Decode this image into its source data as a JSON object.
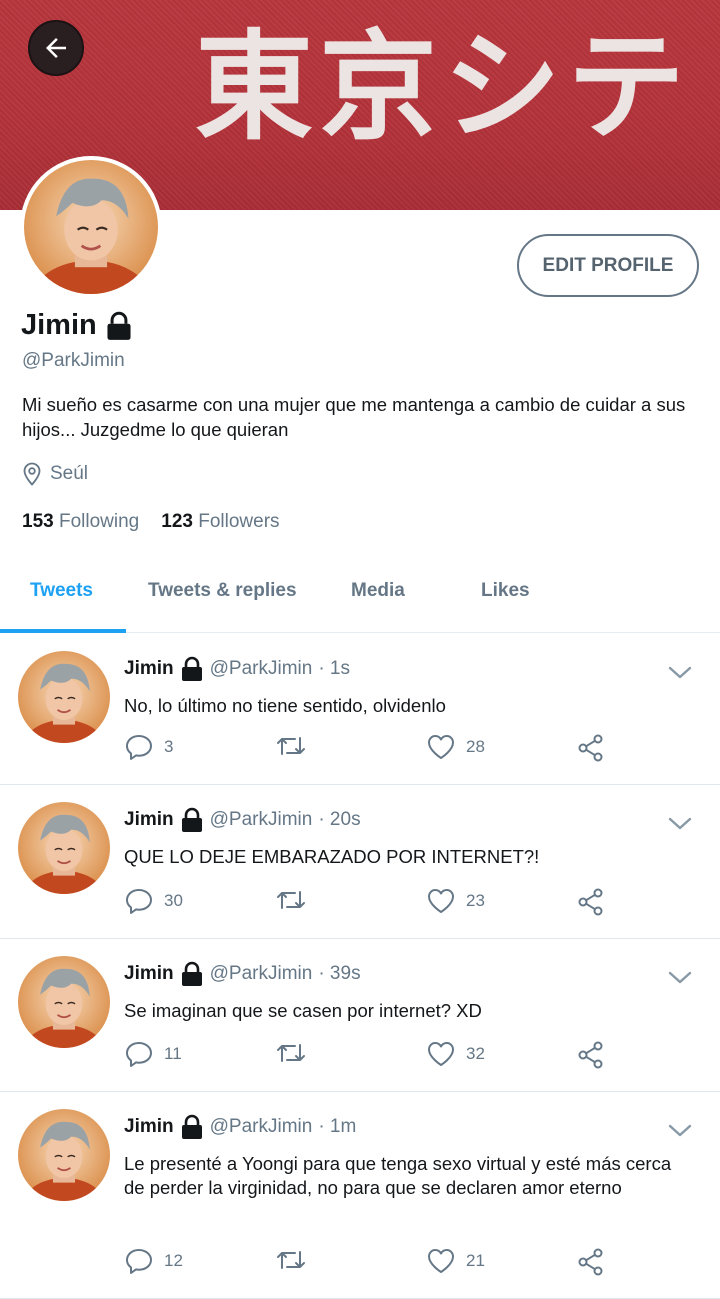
{
  "banner": {
    "text": "東京シテ"
  },
  "profile": {
    "name": "Jimin",
    "handle": "@ParkJimin",
    "bio": "Mi sueño es casarme con una mujer que me mantenga a cambio de cuidar a sus hijos... Juzgedme lo que quieran",
    "location": "Seúl",
    "following_count": "153",
    "following_label": "Following",
    "followers_count": "123",
    "followers_label": "Followers",
    "edit_label": "EDIT PROFILE"
  },
  "tabs": [
    {
      "label": "Tweets",
      "active": true
    },
    {
      "label": "Tweets & replies",
      "active": false
    },
    {
      "label": "Media",
      "active": false
    },
    {
      "label": "Likes",
      "active": false
    }
  ],
  "tweets": [
    {
      "name": "Jimin",
      "handle": "@ParkJimin",
      "time": "· 1s",
      "text": "No, lo último no tiene sentido, olvidenlo",
      "replies": "3",
      "likes": "28"
    },
    {
      "name": "Jimin",
      "handle": "@ParkJimin",
      "time": "· 20s",
      "text": "QUE LO DEJE EMBARAZADO POR INTERNET?!",
      "replies": "30",
      "likes": "23"
    },
    {
      "name": "Jimin",
      "handle": "@ParkJimin",
      "time": "· 39s",
      "text": "Se imaginan que se casen por internet? XD",
      "replies": "11",
      "likes": "32"
    },
    {
      "name": "Jimin",
      "handle": "@ParkJimin",
      "time": "· 1m",
      "text": "Le presenté a Yoongi para que tenga sexo virtual y esté más cerca de perder la virginidad, no para que se declaren amor eterno",
      "replies": "12",
      "likes": "21"
    }
  ],
  "icons": {
    "back": "arrow-left-icon",
    "lock": "lock-icon",
    "location": "location-pin-icon",
    "reply": "reply-icon",
    "retweet": "retweet-icon",
    "like": "heart-icon",
    "share": "share-icon",
    "more": "chevron-down-icon"
  },
  "colors": {
    "accent": "#1da1f2",
    "banner": "#b3323a",
    "muted": "#657786"
  }
}
